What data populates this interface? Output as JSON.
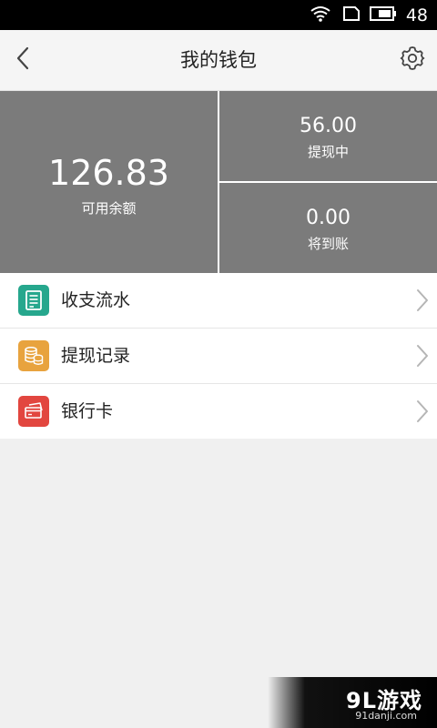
{
  "status_bar": {
    "time": "48"
  },
  "header": {
    "title": "我的钱包",
    "back_icon": "chevron-left-icon",
    "settings_icon": "gear-icon"
  },
  "balance": {
    "available_amount": "126.83",
    "available_label": "可用余额",
    "withdrawing_amount": "56.00",
    "withdrawing_label": "提现中",
    "pending_amount": "0.00",
    "pending_label": "将到账"
  },
  "menu": {
    "items": [
      {
        "label": "收支流水",
        "icon": "ledger-icon",
        "color": "#26a78d"
      },
      {
        "label": "提现记录",
        "icon": "coins-icon",
        "color": "#e8a33e"
      },
      {
        "label": "银行卡",
        "icon": "bank-card-icon",
        "color": "#e2463f"
      }
    ]
  },
  "watermark": {
    "logo": "9L游戏",
    "site": "91danji.com"
  },
  "colors": {
    "panel": "#7b7b7b",
    "background": "#f0f0f0",
    "nav": "#f5f5f5"
  }
}
